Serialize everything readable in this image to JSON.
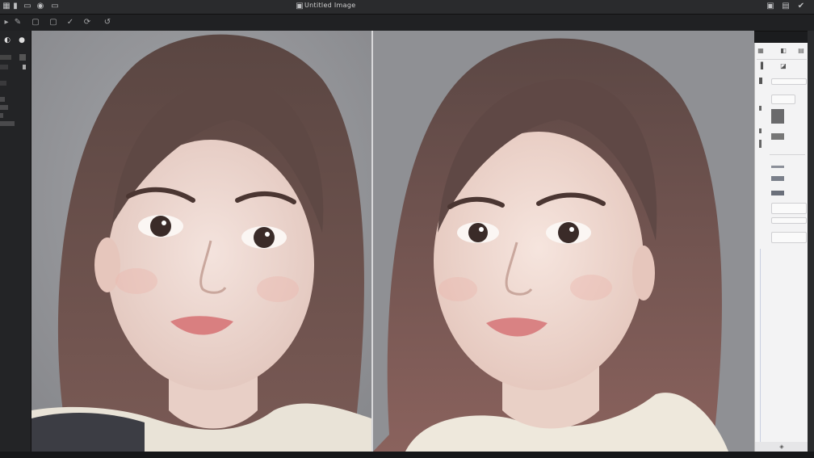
{
  "window": {
    "title": "Untitled Image"
  },
  "titlebar": {
    "left_icons": [
      "grid-icon",
      "file-icon",
      "copy-icon",
      "eye-icon",
      "swap-icon"
    ],
    "right_icons": [
      "crop-icon",
      "export-icon",
      "check-icon"
    ]
  },
  "options_bar": {
    "icons": [
      "brush-icon",
      "pencil-icon",
      "camera-icon",
      "checkmark-icon",
      "rotate-icon",
      "lasso-icon"
    ]
  },
  "canvas": {
    "background_color": "#8e8f93",
    "images": [
      "portrait-before",
      "portrait-after"
    ]
  },
  "right_panel": {
    "tabs": [
      "layers-icon",
      "adjust-icon",
      "history-icon"
    ]
  }
}
